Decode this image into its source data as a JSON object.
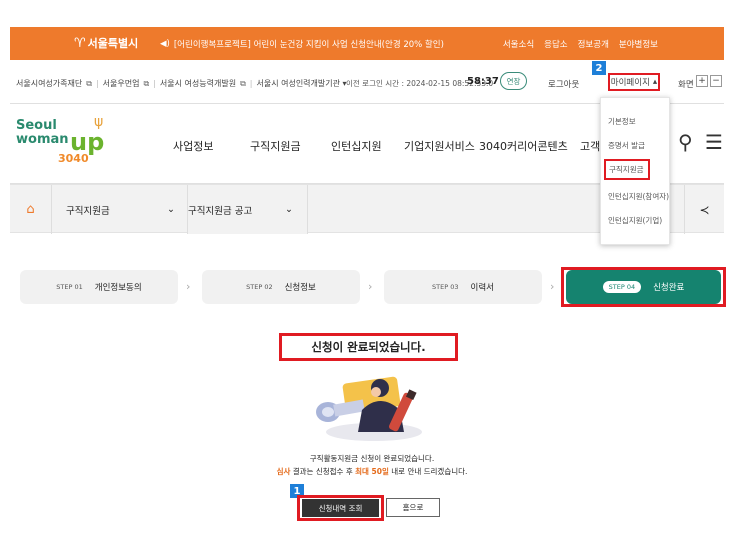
{
  "topbar": {
    "logo": "서울특별시",
    "notice": "[어린이행복프로젝트] 어린이 눈건강 지킴이 사업 신청안내(안경 20% 할인)",
    "links": [
      "서울소식",
      "응답소",
      "정보공개",
      "분야별정보"
    ]
  },
  "utilbar": {
    "sites": [
      "서울시여성가족재단",
      "서울우먼업",
      "서울시 여성능력개발원",
      "서울시 여성인력개발기관 ▾"
    ],
    "login_info": "이전 로그인 시간 : 2024-02-15 08:52:53.0",
    "timer": "58:37",
    "extend": "연장",
    "logout": "로그아웃",
    "mypage": "마이페이지",
    "screen": "화면",
    "zoom_in": "+",
    "zoom_out": "−"
  },
  "brand": {
    "line1": "Seoul",
    "line2": "woman",
    "line3": "up",
    "line4": "3040"
  },
  "nav": [
    "사업정보",
    "구직지원금",
    "인턴십지원",
    "기업지원서비스",
    "3040커리어콘텐츠",
    "고객"
  ],
  "dropdown": [
    "기본정보",
    "증명서 발급",
    "구직지원금",
    "인턴십지원(참여자)",
    "인턴십지원(기업)"
  ],
  "subnav": {
    "menu1": "구직지원금",
    "menu2": "구직지원금 공고"
  },
  "steps": [
    {
      "num": "STEP 01",
      "label": "개인정보동의"
    },
    {
      "num": "STEP 02",
      "label": "신청정보"
    },
    {
      "num": "STEP 03",
      "label": "이력서"
    },
    {
      "num": "STEP 04",
      "label": "신청완료"
    }
  ],
  "complete": {
    "title": "신청이 완료되었습니다.",
    "msg1": "구직활동지원금 신청이 완료되었습니다.",
    "msg2_a": "심사",
    "msg2_b": " 결과는 신청접수 후 ",
    "msg2_c": "최대 50일",
    "msg2_d": " 내로 안내 드리겠습니다."
  },
  "buttons": {
    "view": "신청내역 조회",
    "home": "홈으로"
  },
  "badges": {
    "one": "1",
    "two": "2"
  },
  "colors": {
    "brand_orange": "#ee7a2c",
    "step_active": "#15836f",
    "highlight": "#e01b22",
    "badge": "#1e7fd8"
  }
}
